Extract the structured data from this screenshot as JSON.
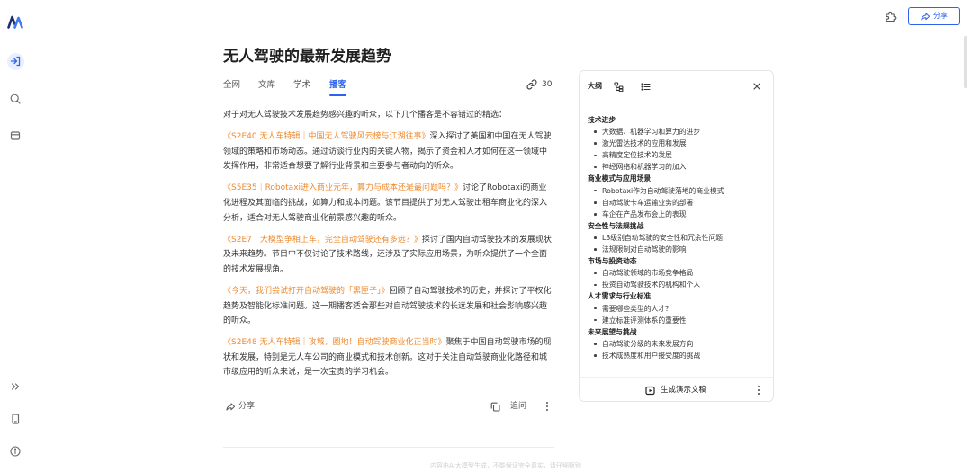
{
  "theme": {
    "accent": "#2d62f0",
    "link": "#ef8a2e",
    "text": "#333333"
  },
  "sidebar": {
    "logo_icon": "app-logo-icon",
    "top_items": [
      {
        "icon": "collapse-sidebar-icon",
        "active": true
      },
      {
        "icon": "search-icon",
        "active": false
      },
      {
        "icon": "library-icon",
        "active": false
      }
    ],
    "bottom_items": [
      {
        "icon": "double-chevron-icon"
      },
      {
        "icon": "mobile-app-icon"
      },
      {
        "icon": "info-icon"
      }
    ]
  },
  "topbar": {
    "extension_icon": "puzzle-icon",
    "share_icon": "share-icon",
    "share_label": "分享"
  },
  "main": {
    "title": "无人驾驶的最新发展趋势",
    "tabs": [
      {
        "label": "全网",
        "active": false
      },
      {
        "label": "文库",
        "active": false
      },
      {
        "label": "学术",
        "active": false
      },
      {
        "label": "播客",
        "active": true
      }
    ],
    "source_count": "30",
    "intro": "对于对无人驾驶技术发展趋势感兴趣的听众，以下几个播客是不容错过的精选：",
    "podcasts": [
      {
        "title": "《S2E40 无人车特辑｜中国无人驾驶风云榜与江湖往事》",
        "summary": "深入探讨了美国和中国在无人驾驶领域的策略和市场动态。通过访谈行业内的关键人物，揭示了资金和人才如何在这一领域中发挥作用，非常适合想要了解行业背景和主要参与者动向的听众。"
      },
      {
        "title": "《S5E35｜Robotaxi进入商业元年，算力与成本还是最问题吗？》",
        "summary": "讨论了Robotaxi的商业化进程及其面临的挑战，如算力和成本问题。该节目提供了对无人驾驶出租车商业化的深入分析，适合对无人驾驶商业化前景感兴趣的听众。"
      },
      {
        "title": "《S2E7｜大模型争相上车，完全自动驾驶还有多远？》",
        "summary": "探讨了国内自动驾驶技术的发展现状及未来趋势。节目中不仅讨论了技术路线，还涉及了实际应用场景，为听众提供了一个全面的技术发展视角。"
      },
      {
        "title": "《今天，我们尝试打开自动驾驶的「黑匣子」》",
        "summary": "回顾了自动驾驶技术的历史，并探讨了平权化趋势及智能化标准问题。这一期播客适合那些对自动驾驶技术的长远发展和社会影响感兴趣的听众。"
      },
      {
        "title": "《S2E48 无人车特辑｜攻城，圈地！自动驾驶商业化正当时》",
        "summary": "聚焦于中国自动驾驶市场的现状和发展，特别是无人车公司的商业模式和技术创新。这对于关注自动驾驶商业化路径和城市级应用的听众来说，是一次宝贵的学习机会。"
      }
    ],
    "actions": {
      "share_label": "分享",
      "follow_up_label": "追问"
    },
    "disclaimer": "内容由AI大模型生成，不能保证完全真实，请仔细甄别"
  },
  "outline": {
    "active_tab": "大纲",
    "view_icons": [
      "mindmap-icon",
      "list-icon"
    ],
    "sections": [
      {
        "heading": "技术进步",
        "points": [
          "大数据、机器学习和算力的进步",
          "激光雷达技术的应用和发展",
          "高精度定位技术的发展",
          "神经网络和机器学习的加入"
        ]
      },
      {
        "heading": "商业模式与应用场景",
        "points": [
          "Robotaxi作为自动驾驶落地的商业模式",
          "自动驾驶卡车运输业务的部署",
          "车企在产品发布会上的表现"
        ]
      },
      {
        "heading": "安全性与法规挑战",
        "points": [
          "L3级别自动驾驶的安全性和冗余性问题",
          "法规限制对自动驾驶的影响"
        ]
      },
      {
        "heading": "市场与投资动态",
        "points": [
          "自动驾驶领域的市场竞争格局",
          "投资自动驾驶技术的机构和个人"
        ]
      },
      {
        "heading": "人才需求与行业标准",
        "points": [
          "需要哪些类型的人才？",
          "建立标准评测体系的重要性"
        ]
      },
      {
        "heading": "未来展望与挑战",
        "points": [
          "自动驾驶分级的未来发展方向",
          "技术成熟度和用户接受度的挑战"
        ]
      }
    ],
    "generate_label": "生成演示文稿"
  }
}
